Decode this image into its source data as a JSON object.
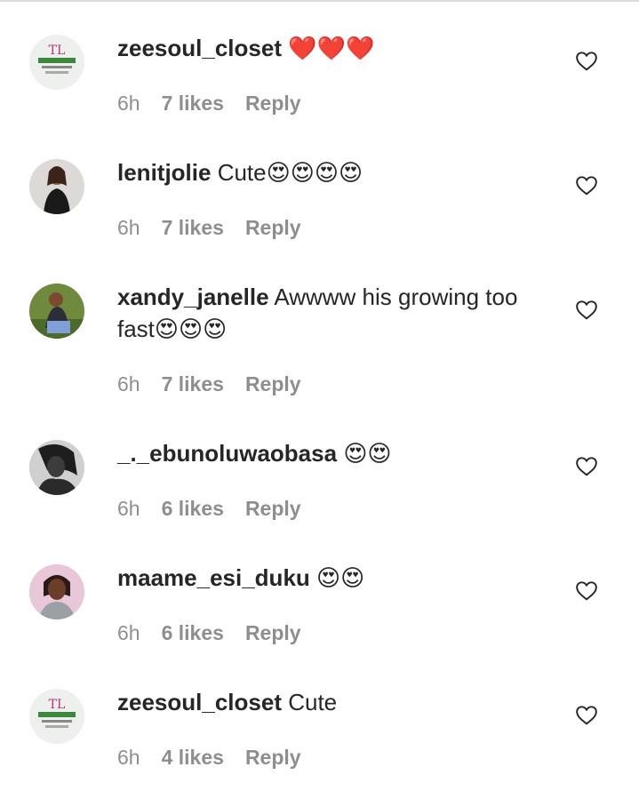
{
  "comments": [
    {
      "username": "zeesoul_closet",
      "text": " ",
      "emoji": "❤️❤️❤️",
      "time": "6h",
      "likes": "7 likes",
      "reply": "Reply",
      "avatar_icon": "zeesoul-logo"
    },
    {
      "username": "lenitjolie",
      "text": " Cute",
      "emoji": "😍😍😍😍",
      "time": "6h",
      "likes": "7 likes",
      "reply": "Reply",
      "avatar_icon": "user-photo"
    },
    {
      "username": "xandy_janelle",
      "text": " Awwww his growing too fast",
      "emoji": "😍😍😍",
      "time": "6h",
      "likes": "7 likes",
      "reply": "Reply",
      "avatar_icon": "user-photo"
    },
    {
      "username": "_._ebunoluwaobasa",
      "text": " ",
      "emoji": "😍😍",
      "time": "6h",
      "likes": "6 likes",
      "reply": "Reply",
      "avatar_icon": "user-photo"
    },
    {
      "username": "maame_esi_duku",
      "text": " ",
      "emoji": "😍😍",
      "time": "6h",
      "likes": "6 likes",
      "reply": "Reply",
      "avatar_icon": "user-photo"
    },
    {
      "username": "zeesoul_closet",
      "text": " Cute",
      "emoji": "",
      "time": "6h",
      "likes": "4 likes",
      "reply": "Reply",
      "avatar_icon": "zeesoul-logo"
    }
  ],
  "colors": {
    "text": "#262626",
    "meta": "#8e8e8e",
    "heart": "#e0245e"
  }
}
